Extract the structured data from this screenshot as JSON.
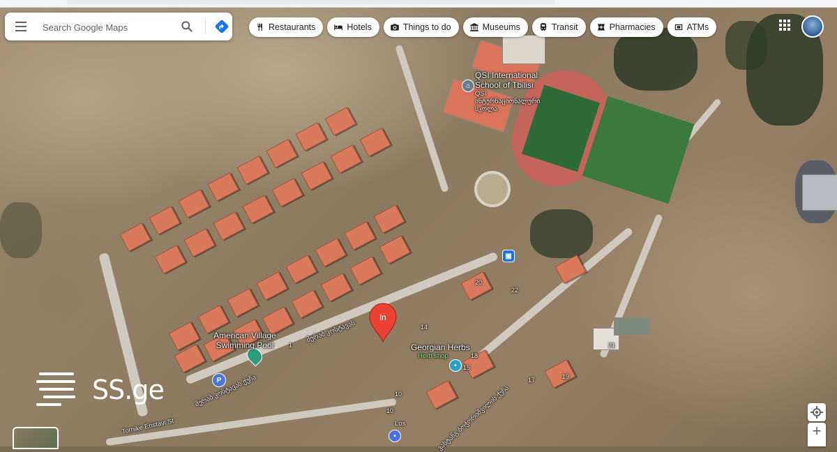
{
  "search": {
    "placeholder": "Search Google Maps"
  },
  "chips": [
    {
      "label": "Restaurants",
      "icon": "fork-knife-icon"
    },
    {
      "label": "Hotels",
      "icon": "bed-icon"
    },
    {
      "label": "Things to do",
      "icon": "camera-icon"
    },
    {
      "label": "Museums",
      "icon": "museum-icon"
    },
    {
      "label": "Transit",
      "icon": "train-icon"
    },
    {
      "label": "Pharmacies",
      "icon": "pharmacy-icon"
    },
    {
      "label": "ATMs",
      "icon": "atm-icon"
    }
  ],
  "places": {
    "school_name": "QSI International School of Tbilisi",
    "school_native": "QSI ინტერნაციონალური სკოლა",
    "pool_name": "American Village Swimming Pool",
    "herbs_name": "Georgian Herbs",
    "herbs_category": "Herb shop",
    "street_eristavi": "Tornike Eristavi St",
    "los_label": "Los",
    "street_ge_1": "მერაბ კოსტავას",
    "street_ge_2": "მერაბ კოსტავას ქუჩა",
    "street_ge_3": "ვახტანგ ბოჭორიშვილის ქუჩა",
    "house_numbers": [
      "20",
      "22",
      "14",
      "18",
      "15",
      "17",
      "19",
      "1",
      "10",
      "21",
      "10"
    ]
  },
  "pin": {
    "label": "ln"
  },
  "watermark": {
    "text": "SS.ge"
  },
  "controls": {
    "zoom_in": "+"
  },
  "colors": {
    "pin_red": "#ea4335",
    "chip_bg": "#ffffff",
    "directions_blue": "#1a73e8"
  }
}
